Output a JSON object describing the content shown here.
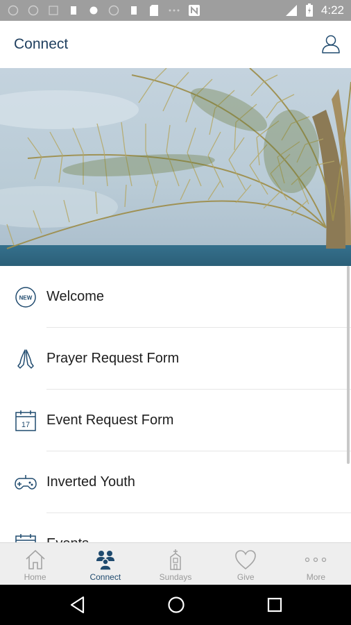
{
  "status_bar": {
    "time": "4:22"
  },
  "header": {
    "title": "Connect",
    "profile_icon": "user-icon"
  },
  "menu": {
    "items": [
      {
        "label": "Welcome",
        "icon": "new-badge-icon"
      },
      {
        "label": "Prayer Request Form",
        "icon": "praying-hands-icon"
      },
      {
        "label": "Event Request Form",
        "icon": "calendar-icon"
      },
      {
        "label": "Inverted Youth",
        "icon": "gamepad-icon"
      },
      {
        "label": "Events",
        "icon": "calendar-icon"
      }
    ]
  },
  "tabs": [
    {
      "label": "Home",
      "icon": "home-icon",
      "active": false
    },
    {
      "label": "Connect",
      "icon": "people-icon",
      "active": true
    },
    {
      "label": "Sundays",
      "icon": "church-icon",
      "active": false
    },
    {
      "label": "Give",
      "icon": "heart-icon",
      "active": false
    },
    {
      "label": "More",
      "icon": "more-icon",
      "active": false
    }
  ],
  "colors": {
    "accent": "#1f4a6e",
    "title": "#1f3f5f",
    "inactive": "#9a9a9a"
  }
}
